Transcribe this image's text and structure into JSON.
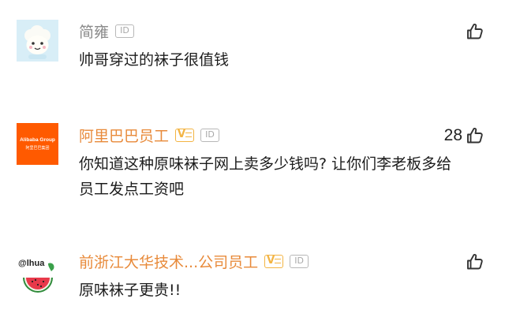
{
  "comments": [
    {
      "author": "简雍",
      "content": "帅哥穿过的袜子很值钱",
      "likes": "",
      "avatar_icon": "cartoon-sheep-avatar",
      "id_badge": "ID"
    },
    {
      "author": "阿里巴巴员工",
      "content": "你知道这种原味袜子网上卖多少钱吗? 让你们李老板多给员工发点工资吧",
      "likes": "28",
      "avatar_icon": "alibaba-logo-avatar",
      "avatar_brand": "Alibaba Group",
      "avatar_subtext": "阿里巴巴集团",
      "verified_badge": "V",
      "id_badge": "ID"
    },
    {
      "author": "前浙江大华技术...公司员工",
      "content": "原味袜子更贵!!",
      "likes": "",
      "avatar_icon": "watermelon-avatar",
      "avatar_text": "@lhua",
      "verified_badge": "V",
      "id_badge": "ID"
    }
  ],
  "colors": {
    "author_gray": "#8a8a8a",
    "author_orange": "#e88a3a",
    "badge_gold": "#f3b443",
    "alibaba_orange": "#ff5a00",
    "text": "#1c1c1c"
  }
}
